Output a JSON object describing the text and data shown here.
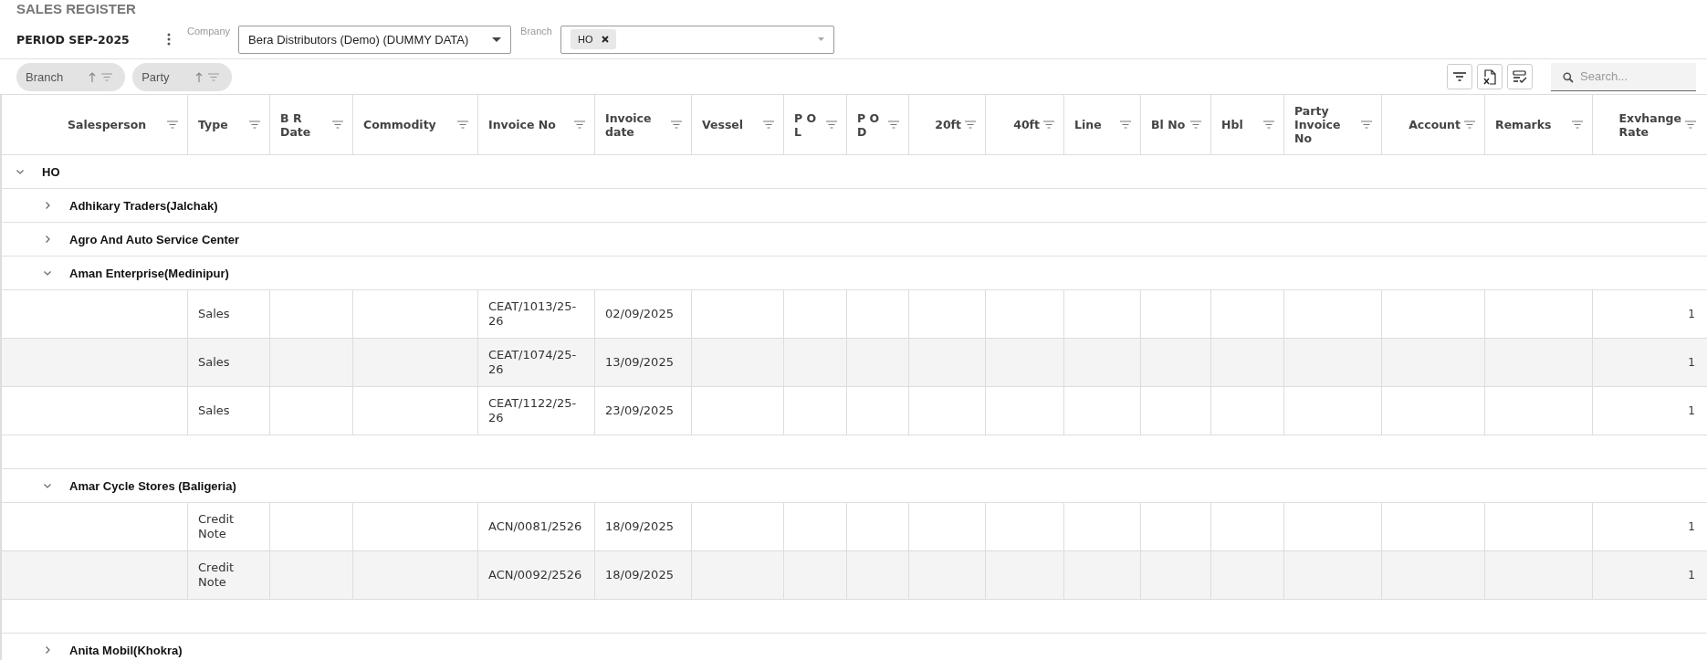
{
  "title": "SALES REGISTER",
  "period": "PERIOD SEP-2025",
  "company": {
    "label": "Company",
    "value": "Bera Distributors (Demo) (DUMMY DATA)"
  },
  "branch": {
    "label": "Branch",
    "chips": [
      "HO"
    ]
  },
  "group_chips": [
    {
      "label": "Branch"
    },
    {
      "label": "Party"
    }
  ],
  "search": {
    "placeholder": "Search..."
  },
  "table": {
    "columns": [
      {
        "label": "Salesperson",
        "numeric": false
      },
      {
        "label": "Type",
        "numeric": false
      },
      {
        "label": "B R\nDate",
        "numeric": false
      },
      {
        "label": "Commodity",
        "numeric": false
      },
      {
        "label": "Invoice No",
        "numeric": false
      },
      {
        "label": "Invoice\ndate",
        "numeric": false
      },
      {
        "label": "Vessel",
        "numeric": false
      },
      {
        "label": "P O\nL",
        "numeric": false
      },
      {
        "label": "P O\nD",
        "numeric": false
      },
      {
        "label": "20ft",
        "numeric": true
      },
      {
        "label": "40ft",
        "numeric": true
      },
      {
        "label": "Line",
        "numeric": false
      },
      {
        "label": "Bl No",
        "numeric": false
      },
      {
        "label": "Hbl",
        "numeric": false
      },
      {
        "label": "Party\nInvoice\nNo",
        "numeric": false
      },
      {
        "label": "Account",
        "numeric": true
      },
      {
        "label": "Remarks",
        "numeric": false
      },
      {
        "label": "Exvhange\nRate",
        "numeric": true
      }
    ],
    "groups": [
      {
        "label": "HO",
        "expanded": true,
        "children": [
          {
            "label": "Adhikary Traders(Jalchak)",
            "expanded": false
          },
          {
            "label": "Agro And Auto Service Center",
            "expanded": false
          },
          {
            "label": "Aman Enterprise(Medinipur)",
            "expanded": true,
            "rows": [
              {
                "type": "Sales",
                "invoice_no": "CEAT/1013/25-26",
                "invoice_date": "02/09/2025",
                "exchange_rate": "1"
              },
              {
                "type": "Sales",
                "invoice_no": "CEAT/1074/25-26",
                "invoice_date": "13/09/2025",
                "exchange_rate": "1"
              },
              {
                "type": "Sales",
                "invoice_no": "CEAT/1122/25-26",
                "invoice_date": "23/09/2025",
                "exchange_rate": "1"
              }
            ]
          },
          {
            "label": "Amar Cycle Stores (Baligeria)",
            "expanded": true,
            "rows": [
              {
                "type": "Credit Note",
                "invoice_no": "ACN/0081/2526",
                "invoice_date": "18/09/2025",
                "exchange_rate": "1"
              },
              {
                "type": "Credit Note",
                "invoice_no": "ACN/0092/2526",
                "invoice_date": "18/09/2025",
                "exchange_rate": "1"
              }
            ]
          },
          {
            "label": "Anita Mobil(Khokra)",
            "expanded": false
          }
        ]
      }
    ]
  }
}
